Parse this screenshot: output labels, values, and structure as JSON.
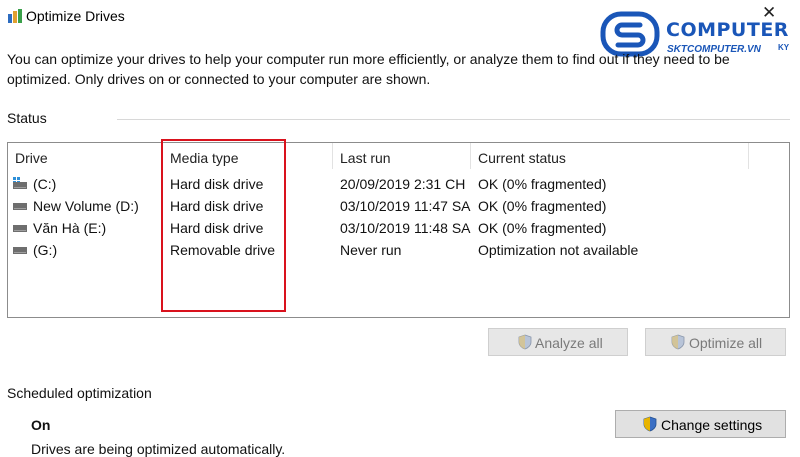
{
  "window": {
    "title": "Optimize Drives",
    "close_glyph": "✕"
  },
  "watermark": {
    "brand": "COMPUTER",
    "domain": "SKTCOMPUTER.VN",
    "suffix": "KY"
  },
  "description": "You can optimize your drives to help your computer run more efficiently, or analyze them to find out if they need to be optimized. Only drives on or connected to your computer are shown.",
  "status": {
    "label": "Status",
    "columns": [
      "Drive",
      "Media type",
      "Last run",
      "Current status"
    ],
    "rows": [
      {
        "drive": "(C:)",
        "media": "Hard disk drive",
        "last_run": "20/09/2019 2:31 CH",
        "status": "OK (0% fragmented)",
        "icon": "system-drive-icon"
      },
      {
        "drive": "New Volume (D:)",
        "media": "Hard disk drive",
        "last_run": "03/10/2019 11:47 SA",
        "status": "OK (0% fragmented)",
        "icon": "hard-drive-icon"
      },
      {
        "drive": "Văn Hà (E:)",
        "media": "Hard disk drive",
        "last_run": "03/10/2019 11:48 SA",
        "status": "OK (0% fragmented)",
        "icon": "hard-drive-icon"
      },
      {
        "drive": "(G:)",
        "media": "Removable drive",
        "last_run": "Never run",
        "status": "Optimization not available",
        "icon": "removable-drive-icon"
      }
    ]
  },
  "buttons": {
    "analyze_all": "Analyze all",
    "optimize_all": "Optimize all"
  },
  "scheduled": {
    "label": "Scheduled optimization",
    "state": "On",
    "detail": "Drives are being optimized automatically.",
    "change_settings": "Change settings"
  },
  "colors": {
    "highlight_border": "#d9121d",
    "brand_blue": "#1a56b8"
  }
}
